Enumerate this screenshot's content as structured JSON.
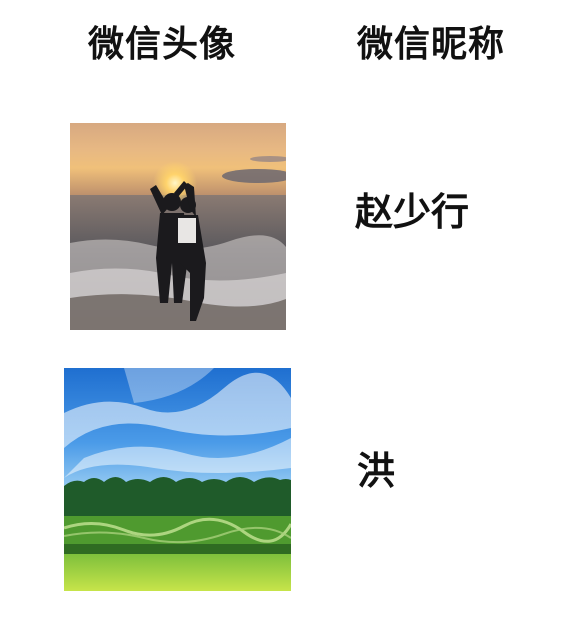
{
  "headers": {
    "avatar_col": "微信头像",
    "nickname_col": "微信昵称"
  },
  "rows": [
    {
      "avatar_icon": "sunset-beach-couple-photo",
      "nickname": "赵少行"
    },
    {
      "avatar_icon": "blue-sky-green-field-photo",
      "nickname": "洪"
    }
  ]
}
